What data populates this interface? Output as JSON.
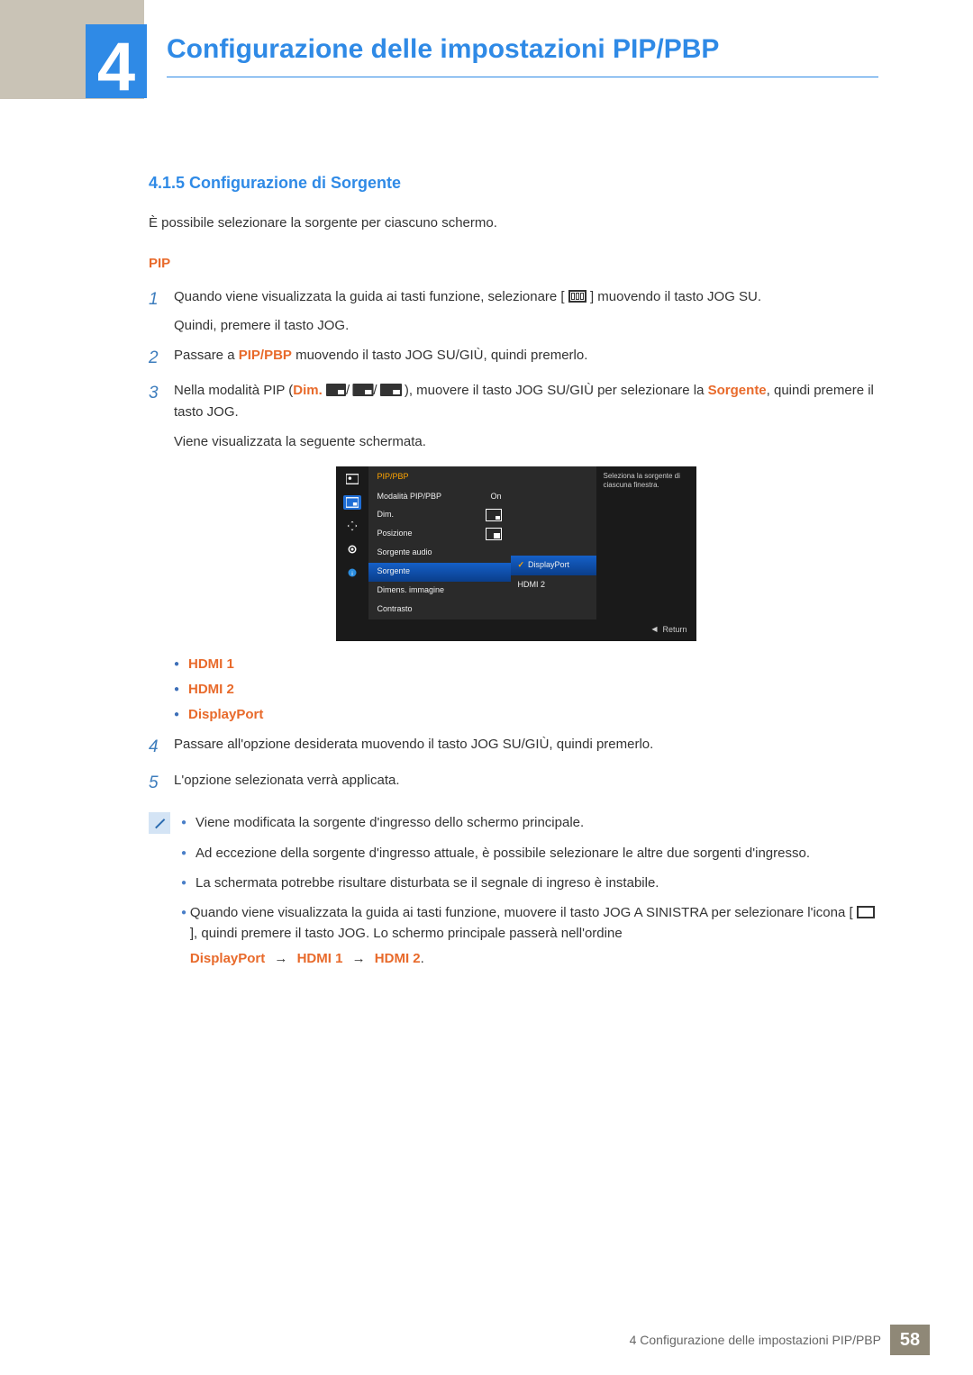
{
  "chapter": {
    "number": "4",
    "title": "Configurazione delle impostazioni PIP/PBP"
  },
  "section": {
    "number_title": "4.1.5 Configurazione di Sorgente",
    "intro": "È possibile selezionare la sorgente per ciascuno schermo."
  },
  "pip_heading": "PIP",
  "steps": {
    "s1a": "Quando viene visualizzata la guida ai tasti funzione, selezionare [",
    "s1b": "] muovendo il tasto JOG SU.",
    "s1c": "Quindi, premere il tasto JOG.",
    "s2a": "Passare a ",
    "s2_pip": "PIP/PBP",
    "s2b": " muovendo il tasto JOG SU/GIÙ, quindi premerlo.",
    "s3a": "Nella modalità PIP (",
    "s3_dim": "Dim.",
    "s3b": "), muovere il tasto JOG SU/GIÙ per selezionare la ",
    "s3_sorg": "Sorgente",
    "s3c": ", quindi premere il tasto JOG.",
    "s3d": "Viene visualizzata la seguente schermata.",
    "s4": "Passare all'opzione desiderata muovendo il tasto JOG SU/GIÙ, quindi premerlo.",
    "s5": "L'opzione selezionata verrà applicata."
  },
  "osd": {
    "header": "PIP/PBP",
    "rows": {
      "mod": "Modalità PIP/PBP",
      "mod_val": "On",
      "dim": "Dim.",
      "pos": "Posizione",
      "audio": "Sorgente audio",
      "sorg": "Sorgente",
      "dimens": "Dimens. immagine",
      "contrasto": "Contrasto"
    },
    "sub": {
      "dp": "DisplayPort",
      "hdmi2": "HDMI 2"
    },
    "tooltip": "Seleziona la sorgente di ciascuna finestra.",
    "return": "Return"
  },
  "source_options": {
    "h1": "HDMI 1",
    "h2": "HDMI 2",
    "dp": "DisplayPort"
  },
  "notes": {
    "n1": "Viene modificata la sorgente d'ingresso dello schermo principale.",
    "n2": "Ad eccezione della sorgente d'ingresso attuale, è possibile selezionare le altre due sorgenti d'ingresso.",
    "n3": "La schermata potrebbe risultare disturbata se il segnale di ingreso è instabile.",
    "n4a": "Quando viene visualizzata la guida ai tasti funzione, muovere il tasto JOG A SINISTRA per selezionare l'icona [",
    "n4b": "], quindi premere il tasto JOG. Lo schermo principale passerà nell'ordine",
    "seq_dp": "DisplayPort",
    "seq_h1": "HDMI 1",
    "seq_h2": "HDMI 2"
  },
  "footer": {
    "label": "4 Configurazione delle impostazioni PIP/PBP",
    "page": "58"
  }
}
